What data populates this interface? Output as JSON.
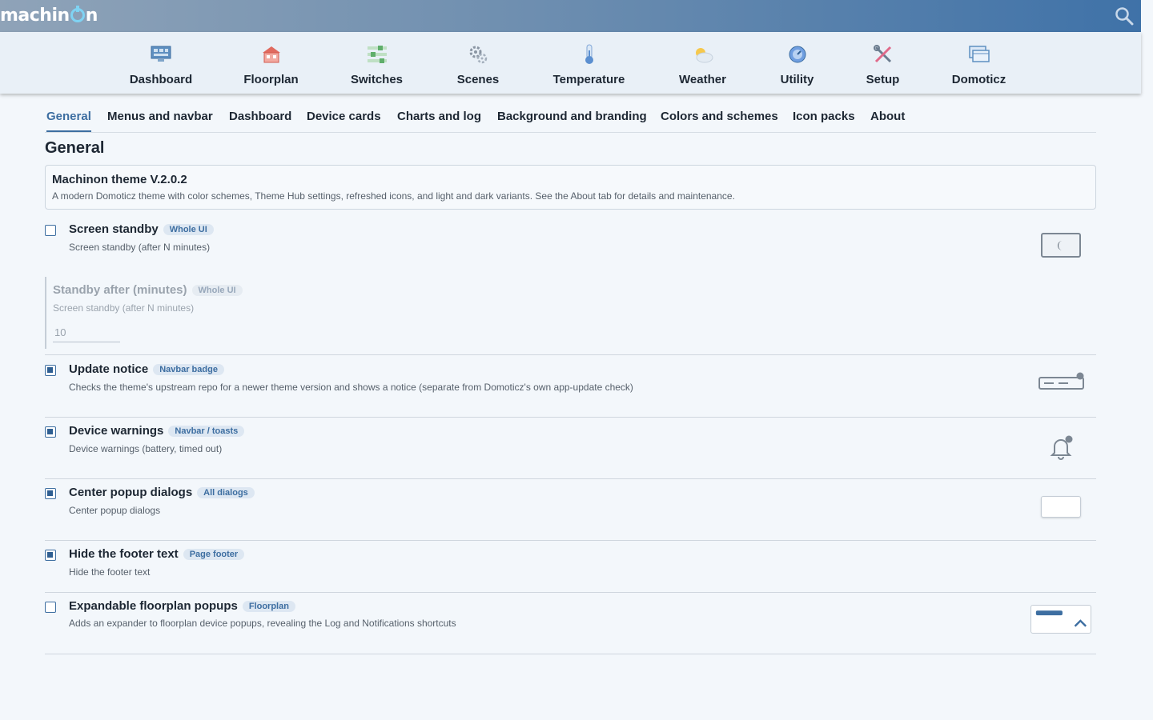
{
  "app": {
    "logo_text": "machinon"
  },
  "navbar": {
    "items": [
      {
        "label": "Dashboard",
        "icon": "dashboard-icon"
      },
      {
        "label": "Floorplan",
        "icon": "floorplan-icon"
      },
      {
        "label": "Switches",
        "icon": "switches-icon"
      },
      {
        "label": "Scenes",
        "icon": "scenes-icon"
      },
      {
        "label": "Temperature",
        "icon": "temperature-icon"
      },
      {
        "label": "Weather",
        "icon": "weather-icon"
      },
      {
        "label": "Utility",
        "icon": "utility-icon"
      },
      {
        "label": "Setup",
        "icon": "setup-icon"
      },
      {
        "label": "Domoticz",
        "icon": "domoticz-icon"
      }
    ]
  },
  "tabs": [
    "General",
    "Menus and navbar",
    "Dashboard",
    "Device cards",
    "Charts and log",
    "Background and branding",
    "Colors and schemes",
    "Icon packs",
    "About"
  ],
  "active_tab": "General",
  "section_title": "General",
  "info": {
    "title": "Machinon theme V.2.0.2",
    "description": "A modern Domoticz theme with color schemes, Theme Hub settings, refreshed icons, and light and dark variants. See the About tab for details and maintenance."
  },
  "options": {
    "screen_standby": {
      "title": "Screen standby",
      "badge": "Whole UI",
      "desc": "Screen standby (after N minutes)",
      "checked": false
    },
    "standby_after": {
      "title": "Standby after (minutes)",
      "badge": "Whole UI",
      "desc": "Screen standby (after N minutes)",
      "value": "10"
    },
    "update_notice": {
      "title": "Update notice",
      "badge": "Navbar badge",
      "desc": "Checks the theme's upstream repo for a newer theme version and shows a notice (separate from Domoticz's own app-update check)",
      "checked": true
    },
    "device_warnings": {
      "title": "Device warnings",
      "badge": "Navbar / toasts",
      "desc": "Device warnings (battery, timed out)",
      "checked": true
    },
    "center_popups": {
      "title": "Center popup dialogs",
      "badge": "All dialogs",
      "desc": "Center popup dialogs",
      "checked": true
    },
    "hide_footer": {
      "title": "Hide the footer text",
      "badge": "Page footer",
      "desc": "Hide the footer text",
      "checked": true
    },
    "expandable_floorplan": {
      "title": "Expandable floorplan popups",
      "badge": "Floorplan",
      "desc": "Adds an expander to floorplan device popups, revealing the Log and Notifications shortcuts",
      "checked": false
    }
  },
  "colors": {
    "accent": "#3d6ea1",
    "topbar_start": "#8fa3b8",
    "topbar_end": "#3f72a8",
    "navbar_bg": "#e9f0f7"
  }
}
